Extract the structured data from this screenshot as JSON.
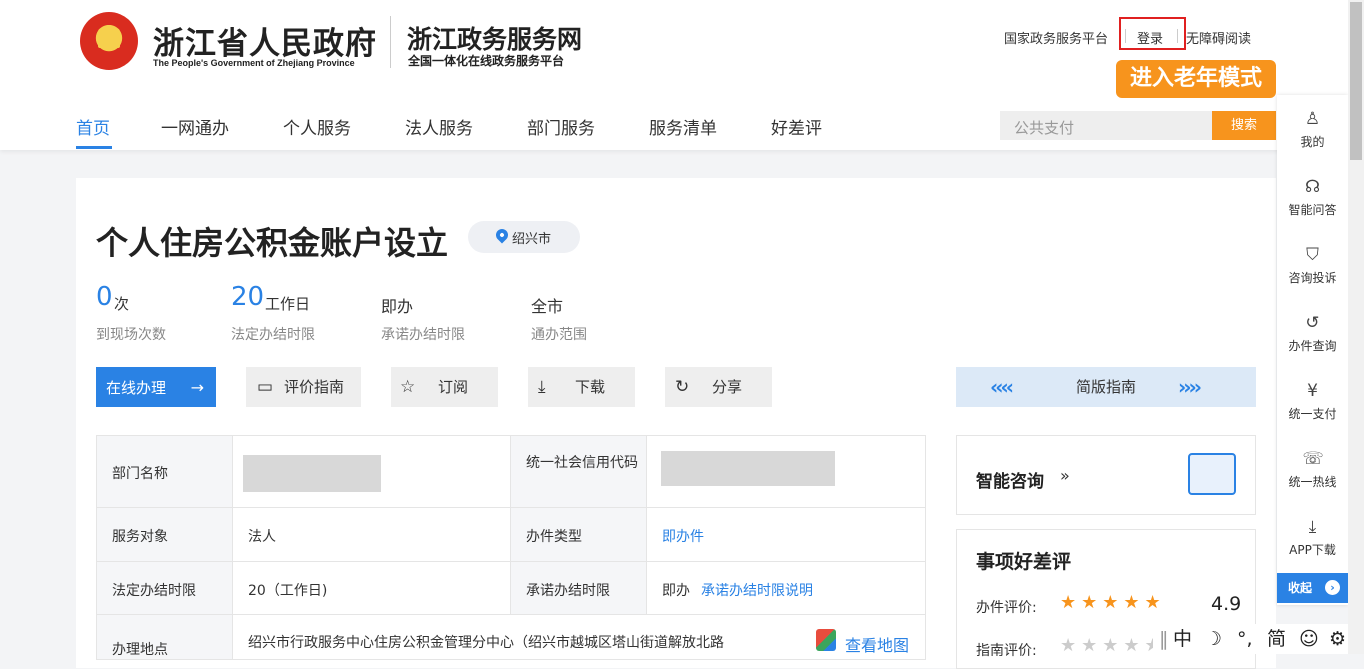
{
  "header": {
    "gov_title": "浙江省人民政府",
    "gov_title_en": "The People's Government of Zhejiang Province",
    "site_title": "浙江政务服务网",
    "site_subtitle": "全国一体化在线政务服务平台",
    "top_links": {
      "national": "国家政务服务平台",
      "login": "登录",
      "accessible": "无障碍阅读"
    },
    "elder_mode": "进入老年模式",
    "nav": [
      "首页",
      "一网通办",
      "个人服务",
      "法人服务",
      "部门服务",
      "服务清单",
      "好差评"
    ],
    "search": {
      "placeholder": "公共支付",
      "button": "搜索"
    }
  },
  "item": {
    "title": "个人住房公积金账户设立",
    "city": "绍兴市",
    "stats": [
      {
        "value": "0",
        "unit": "次",
        "label": "到现场次数"
      },
      {
        "value": "20",
        "unit": "工作日",
        "label": "法定办结时限"
      },
      {
        "value": "即办",
        "label": "承诺办结时限"
      },
      {
        "value": "全市",
        "label": "通办范围"
      }
    ],
    "actions": {
      "online": "在线办理",
      "guide_rate": "评价指南",
      "subscribe": "订阅",
      "download": "下载",
      "share": "分享",
      "simple_guide": "简版指南"
    },
    "table": {
      "dept_label": "部门名称",
      "credit_label": "统一社会信用代码",
      "target_label": "服务对象",
      "target_value": "法人",
      "type_label": "办件类型",
      "type_value": "即办件",
      "legal_label": "法定办结时限",
      "legal_value": "20（工作日)",
      "promise_label": "承诺办结时限",
      "promise_value": "即办",
      "promise_link": "承诺办结时限说明",
      "addr_label": "办理地点",
      "addr_value": "绍兴市行政服务中心住房公积金管理分中心（绍兴市越城区塔山街道解放北路",
      "map_link": "查看地图"
    }
  },
  "aside": {
    "ai_consult": "智能咨询",
    "rating_title": "事项好差评",
    "rating_rows": [
      {
        "label": "办件评价:",
        "stars": 5,
        "score": "4.9"
      },
      {
        "label": "指南评价:",
        "stars": 5,
        "score": ""
      }
    ]
  },
  "sidebar": {
    "items": [
      "我的",
      "智能问答",
      "咨询投诉",
      "办件查询",
      "统一支付",
      "统一热线",
      "APP下载"
    ],
    "collapse": "收起"
  },
  "ime": {
    "mode": "中",
    "moon": "☽",
    "punct": "°,",
    "script": "简",
    "emoji": "☺",
    "gear": "⚙"
  }
}
